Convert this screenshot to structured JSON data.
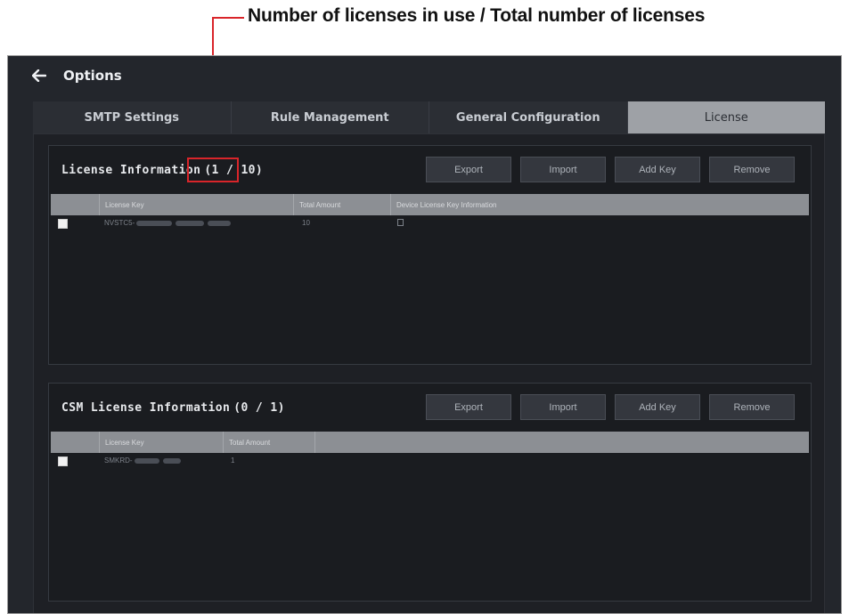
{
  "annotation": {
    "text": "Number of licenses in use / Total number of licenses",
    "color": "#d9252a"
  },
  "header": {
    "title": "Options",
    "back_icon": "arrow-left-icon"
  },
  "tabs": [
    {
      "label": "SMTP Settings",
      "active": false
    },
    {
      "label": "Rule Management",
      "active": false
    },
    {
      "label": "General Configuration",
      "active": false
    },
    {
      "label": "License",
      "active": true
    }
  ],
  "license_panel": {
    "title": "License Information",
    "count": "(1 / 10)",
    "buttons": {
      "export": "Export",
      "import": "Import",
      "add_key": "Add Key",
      "remove": "Remove"
    },
    "columns": [
      "License Key",
      "Total Amount",
      "Device License Key Information"
    ],
    "rows": [
      {
        "license_key": "NVSTC5-",
        "total_amount": "10"
      }
    ]
  },
  "csm_panel": {
    "title": "CSM License Information",
    "count": "(0 / 1)",
    "buttons": {
      "export": "Export",
      "import": "Import",
      "add_key": "Add Key",
      "remove": "Remove"
    },
    "columns": [
      "License Key",
      "Total Amount"
    ],
    "rows": [
      {
        "license_key": "SMKRD-",
        "total_amount": "1"
      }
    ]
  },
  "colors": {
    "background": "#23262c",
    "active_tab": "#9ea1a6",
    "table_header": "#8c8f94"
  }
}
